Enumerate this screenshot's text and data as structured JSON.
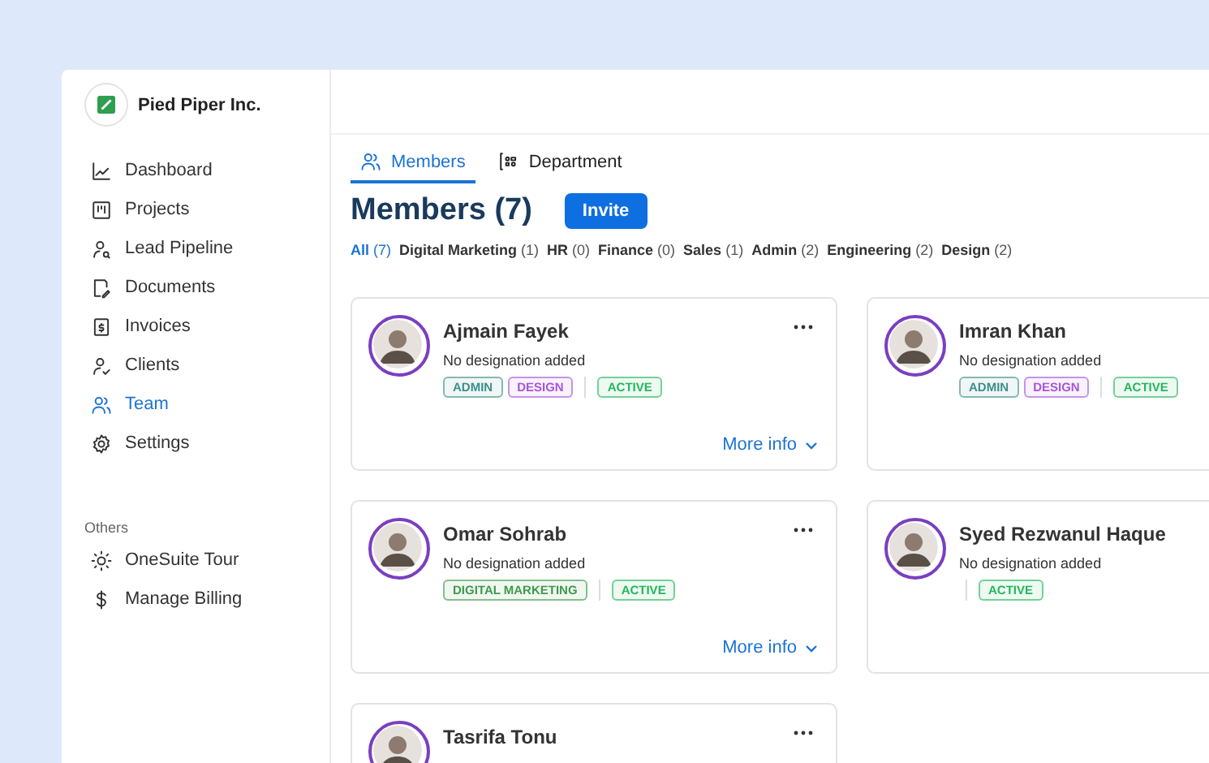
{
  "company": {
    "name": "Pied Piper Inc."
  },
  "nav": [
    {
      "label": "Dashboard",
      "selected": false
    },
    {
      "label": "Projects",
      "selected": false
    },
    {
      "label": "Lead Pipeline",
      "selected": false
    },
    {
      "label": "Documents",
      "selected": false
    },
    {
      "label": "Invoices",
      "selected": false
    },
    {
      "label": "Clients",
      "selected": false
    },
    {
      "label": "Team",
      "selected": true
    },
    {
      "label": "Settings",
      "selected": false
    }
  ],
  "others": {
    "heading": "Others",
    "items": [
      {
        "label": "OneSuite Tour"
      },
      {
        "label": "Manage Billing"
      }
    ]
  },
  "tabs": [
    {
      "label": "Members",
      "selected": true
    },
    {
      "label": "Department",
      "selected": false
    }
  ],
  "title": "Members (7)",
  "invite_button": "Invite",
  "filters": [
    {
      "label": "All",
      "count": "(7)",
      "selected": true
    },
    {
      "label": "Digital Marketing",
      "count": "(1)",
      "selected": false
    },
    {
      "label": "HR",
      "count": "(0)",
      "selected": false
    },
    {
      "label": "Finance",
      "count": "(0)",
      "selected": false
    },
    {
      "label": "Sales",
      "count": "(1)",
      "selected": false
    },
    {
      "label": "Admin",
      "count": "(2)",
      "selected": false
    },
    {
      "label": "Engineering",
      "count": "(2)",
      "selected": false
    },
    {
      "label": "Design",
      "count": "(2)",
      "selected": false
    }
  ],
  "members": [
    {
      "name": "Ajmain Fayek",
      "designation": "No designation added",
      "departments": [
        {
          "label": "ADMIN",
          "color": "#3a8f8a"
        },
        {
          "label": "DESIGN",
          "color": "#a855d8"
        }
      ],
      "status": {
        "label": "ACTIVE",
        "color": "#22b85a"
      },
      "more_info": "More info"
    },
    {
      "name": "Imran Khan",
      "designation": "No designation added",
      "departments": [
        {
          "label": "ADMIN",
          "color": "#3a8f8a"
        },
        {
          "label": "DESIGN",
          "color": "#a855d8"
        }
      ],
      "status": {
        "label": "ACTIVE",
        "color": "#22b85a"
      }
    },
    {
      "name": "Omar Sohrab",
      "designation": "No designation added",
      "departments": [
        {
          "label": "DIGITAL MARKETING",
          "color": "#3f9a4a"
        }
      ],
      "status": {
        "label": "ACTIVE",
        "color": "#22b85a"
      },
      "more_info": "More info"
    },
    {
      "name": "Syed Rezwanul Haque",
      "designation": "No designation added",
      "status": {
        "label": "ACTIVE",
        "color": "#22b85a"
      }
    },
    {
      "name": "Tasrifa Tonu"
    }
  ]
}
